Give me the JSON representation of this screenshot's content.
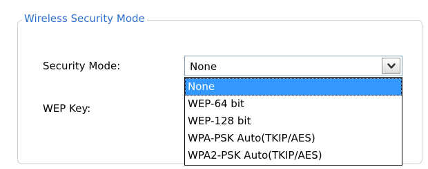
{
  "group": {
    "legend": "Wireless Security Mode"
  },
  "security_mode": {
    "label": "Security Mode:",
    "selected": "None",
    "options": [
      "None",
      "WEP-64 bit",
      "WEP-128 bit",
      "WPA-PSK Auto(TKIP/AES)",
      "WPA2-PSK Auto(TKIP/AES)"
    ],
    "dropdown_icon": "chevron-down-icon",
    "highlight_color": "#3399ff"
  },
  "wep_key": {
    "label": "WEP Key:"
  },
  "colors": {
    "legend": "#2f6fd0",
    "group_border": "#d4d0c8",
    "combo_border": "#7f9db9"
  }
}
